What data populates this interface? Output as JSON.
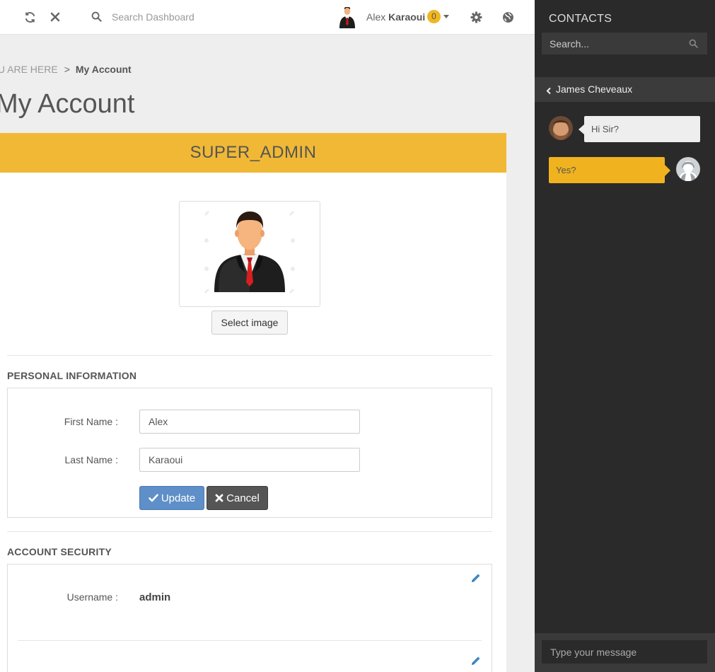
{
  "topbar": {
    "search_placeholder": "Search Dashboard",
    "user_first": "Alex",
    "user_last": "Karaoui",
    "notification_count": "0"
  },
  "breadcrumb": {
    "here": "OU ARE HERE",
    "separator": ">",
    "current": "My Account"
  },
  "page": {
    "title": "My Account",
    "role": "SUPER_ADMIN",
    "select_image_label": "Select image"
  },
  "personal": {
    "section_title": "PERSONAL INFORMATION",
    "first_name_label": "First Name :",
    "first_name_value": "Alex",
    "last_name_label": "Last Name :",
    "last_name_value": "Karaoui",
    "update_label": "Update",
    "cancel_label": "Cancel"
  },
  "security": {
    "section_title": "ACCOUNT SECURITY",
    "username_label": "Username :",
    "username_value": "admin"
  },
  "contacts": {
    "title": "CONTACTS",
    "search_placeholder": "Search...",
    "chat_contact": "James Cheveaux",
    "messages": [
      {
        "from": "contact",
        "text": "Hi Sir?"
      },
      {
        "from": "me",
        "text": "Yes?"
      }
    ],
    "message_placeholder": "Type your message"
  },
  "colors": {
    "accent": "#f0b834",
    "primary_button": "#5e8fc8",
    "sidebar_bg": "#2a2a2a"
  },
  "icons": [
    "refresh-icon",
    "close-icon",
    "search-icon",
    "gear-icon",
    "globe-icon",
    "pencil-icon",
    "chevron-left-icon",
    "check-icon",
    "times-icon"
  ]
}
